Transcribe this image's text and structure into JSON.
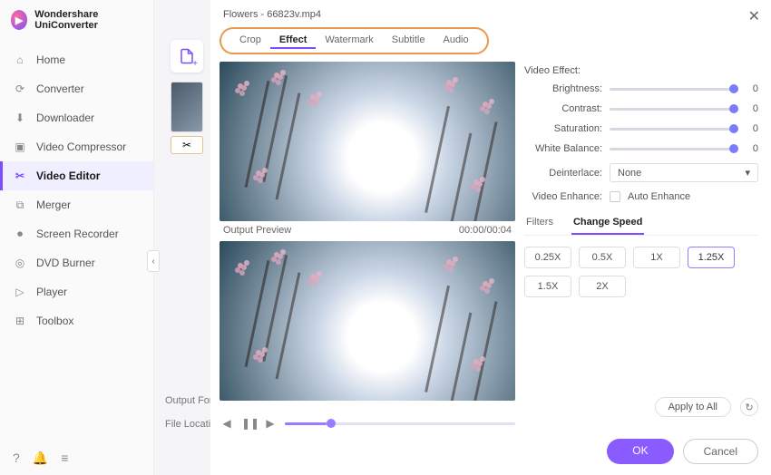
{
  "app": {
    "name": "Wondershare UniConverter"
  },
  "sidebar": {
    "items": [
      {
        "label": "Home"
      },
      {
        "label": "Converter"
      },
      {
        "label": "Downloader"
      },
      {
        "label": "Video Compressor"
      },
      {
        "label": "Video Editor"
      },
      {
        "label": "Merger"
      },
      {
        "label": "Screen Recorder"
      },
      {
        "label": "DVD Burner"
      },
      {
        "label": "Player"
      },
      {
        "label": "Toolbox"
      }
    ]
  },
  "bottom": {
    "output_format": "Output Form",
    "file_location": "File Locatio"
  },
  "editor": {
    "filename": "Flowers - 66823v.mp4",
    "tabs": [
      "Crop",
      "Effect",
      "Watermark",
      "Subtitle",
      "Audio"
    ],
    "active_tab": "Effect",
    "output_preview_label": "Output Preview",
    "time": "00:00/00:04",
    "effect": {
      "heading": "Video Effect:",
      "brightness": {
        "label": "Brightness:",
        "value": "0"
      },
      "contrast": {
        "label": "Contrast:",
        "value": "0"
      },
      "saturation": {
        "label": "Saturation:",
        "value": "0"
      },
      "white_balance": {
        "label": "White Balance:",
        "value": "0"
      },
      "deinterlace": {
        "label": "Deinterlace:",
        "value": "None"
      },
      "enhance": {
        "label": "Video Enhance:",
        "checkbox_label": "Auto Enhance"
      }
    },
    "subtabs": {
      "filters": "Filters",
      "speed": "Change Speed",
      "active": "speed"
    },
    "speeds": [
      "0.25X",
      "0.5X",
      "1X",
      "1.25X",
      "1.5X",
      "2X"
    ],
    "selected_speed": "1.25X",
    "apply_all": "Apply to All",
    "ok": "OK",
    "cancel": "Cancel"
  }
}
